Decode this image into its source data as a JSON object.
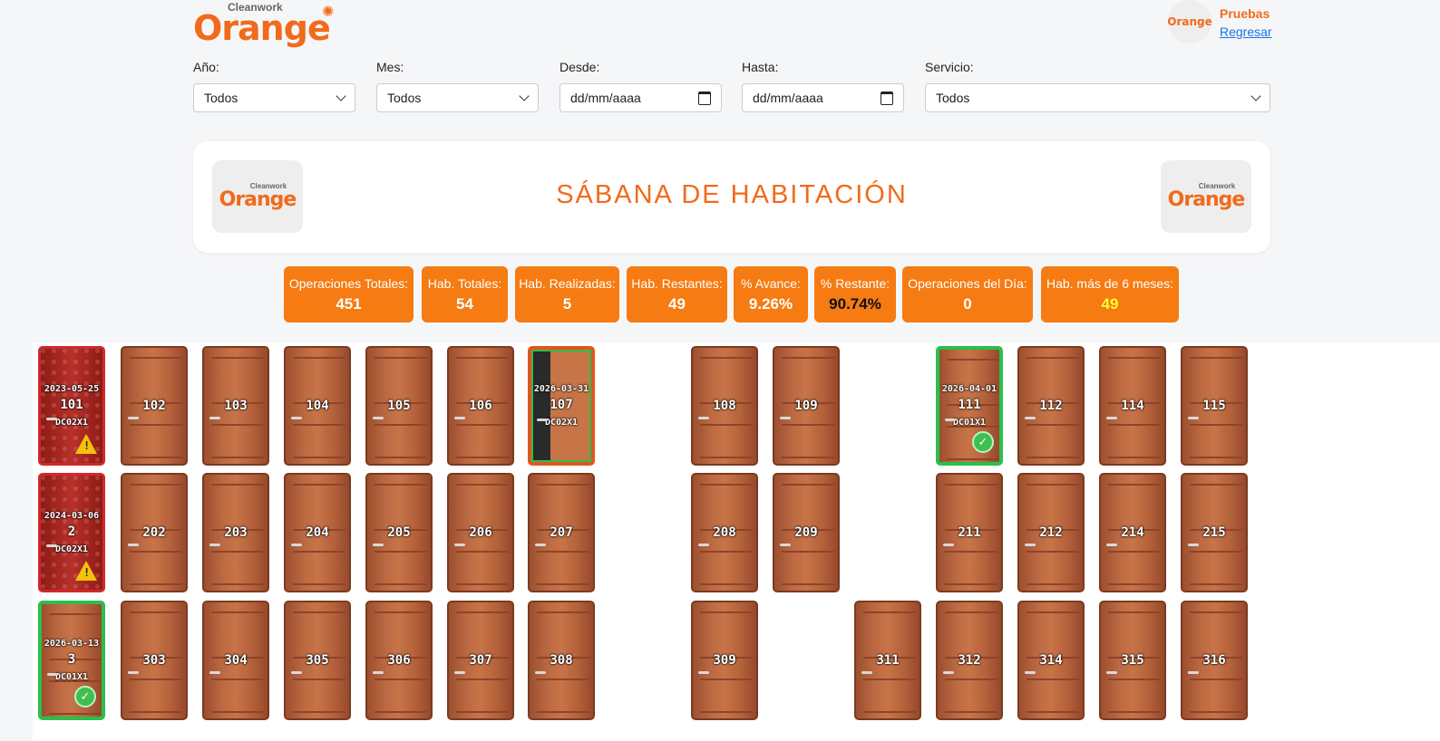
{
  "brand": {
    "small": "Cleanwork",
    "name": "Orange"
  },
  "user": {
    "avatar_text": "Orange",
    "name": "Pruebas",
    "back_link": "Regresar"
  },
  "filters": [
    {
      "label": "Año:",
      "value": "Todos",
      "kind": "select"
    },
    {
      "label": "Mes:",
      "value": "Todos",
      "kind": "select"
    },
    {
      "label": "Desde:",
      "value": "dd/mm/aaaa",
      "kind": "date"
    },
    {
      "label": "Hasta:",
      "value": "dd/mm/aaaa",
      "kind": "date"
    },
    {
      "label": "Servicio:",
      "value": "Todos",
      "kind": "select"
    }
  ],
  "banner": {
    "title": "SÁBANA DE HABITACIÓN"
  },
  "stats": [
    {
      "label": "Operaciones Totales:",
      "value": "451"
    },
    {
      "label": "Hab. Totales:",
      "value": "54"
    },
    {
      "label": "Hab. Realizadas:",
      "value": "5"
    },
    {
      "label": "Hab. Restantes:",
      "value": "49"
    },
    {
      "label": "% Avance:",
      "value": "9.26%"
    },
    {
      "label": "% Restante:",
      "value": "90.74%",
      "value_color": "#111111"
    },
    {
      "label": "Operaciones del Día:",
      "value": "0"
    },
    {
      "label": "Hab. más de 6 meses:",
      "value": "49",
      "value_color": "#ffff33"
    }
  ],
  "rooms": [
    {
      "number": "101",
      "state": "alert",
      "date": "2023-05-25",
      "code": "DC02X1",
      "row": 0,
      "col": 0
    },
    {
      "number": "102",
      "state": "normal",
      "row": 0,
      "col": 1
    },
    {
      "number": "103",
      "state": "normal",
      "row": 0,
      "col": 2
    },
    {
      "number": "104",
      "state": "normal",
      "row": 0,
      "col": 3
    },
    {
      "number": "105",
      "state": "normal",
      "row": 0,
      "col": 4
    },
    {
      "number": "106",
      "state": "normal",
      "row": 0,
      "col": 5
    },
    {
      "number": "107",
      "state": "open",
      "date": "2026-03-31",
      "code": "DC02X1",
      "row": 0,
      "col": 6
    },
    {
      "number": "108",
      "state": "normal",
      "row": 0,
      "col": 8
    },
    {
      "number": "109",
      "state": "normal",
      "row": 0,
      "col": 9
    },
    {
      "number": "111",
      "state": "done",
      "date": "2026-04-01",
      "code": "DC01X1",
      "row": 0,
      "col": 11
    },
    {
      "number": "112",
      "state": "normal",
      "row": 0,
      "col": 12
    },
    {
      "number": "114",
      "state": "normal",
      "row": 0,
      "col": 13
    },
    {
      "number": "115",
      "state": "normal",
      "row": 0,
      "col": 14
    },
    {
      "number": "2",
      "state": "alert",
      "date": "2024-03-06",
      "code": "DC02X1",
      "row": 1,
      "col": 0
    },
    {
      "number": "202",
      "state": "normal",
      "row": 1,
      "col": 1
    },
    {
      "number": "203",
      "state": "normal",
      "row": 1,
      "col": 2
    },
    {
      "number": "204",
      "state": "normal",
      "row": 1,
      "col": 3
    },
    {
      "number": "205",
      "state": "normal",
      "row": 1,
      "col": 4
    },
    {
      "number": "206",
      "state": "normal",
      "row": 1,
      "col": 5
    },
    {
      "number": "207",
      "state": "normal",
      "row": 1,
      "col": 6
    },
    {
      "number": "208",
      "state": "normal",
      "row": 1,
      "col": 8
    },
    {
      "number": "209",
      "state": "normal",
      "row": 1,
      "col": 9
    },
    {
      "number": "211",
      "state": "normal",
      "row": 1,
      "col": 11
    },
    {
      "number": "212",
      "state": "normal",
      "row": 1,
      "col": 12
    },
    {
      "number": "214",
      "state": "normal",
      "row": 1,
      "col": 13
    },
    {
      "number": "215",
      "state": "normal",
      "row": 1,
      "col": 14
    },
    {
      "number": "3",
      "state": "done",
      "date": "2026-03-13",
      "code": "DC01X1",
      "row": 2,
      "col": 0
    },
    {
      "number": "303",
      "state": "normal",
      "row": 2,
      "col": 1
    },
    {
      "number": "304",
      "state": "normal",
      "row": 2,
      "col": 2
    },
    {
      "number": "305",
      "state": "normal",
      "row": 2,
      "col": 3
    },
    {
      "number": "306",
      "state": "normal",
      "row": 2,
      "col": 4
    },
    {
      "number": "307",
      "state": "normal",
      "row": 2,
      "col": 5
    },
    {
      "number": "308",
      "state": "normal",
      "row": 2,
      "col": 6
    },
    {
      "number": "309",
      "state": "normal",
      "row": 2,
      "col": 8
    },
    {
      "number": "311",
      "state": "normal",
      "row": 2,
      "col": 10
    },
    {
      "number": "312",
      "state": "normal",
      "row": 2,
      "col": 11
    },
    {
      "number": "314",
      "state": "normal",
      "row": 2,
      "col": 12
    },
    {
      "number": "315",
      "state": "normal",
      "row": 2,
      "col": 13
    },
    {
      "number": "316",
      "state": "normal",
      "row": 2,
      "col": 14
    }
  ],
  "colors": {
    "accent": "#f26a1b",
    "stat_bg": "#f57b12",
    "alert_border": "#d3272a",
    "done_border": "#2bbf4b"
  }
}
